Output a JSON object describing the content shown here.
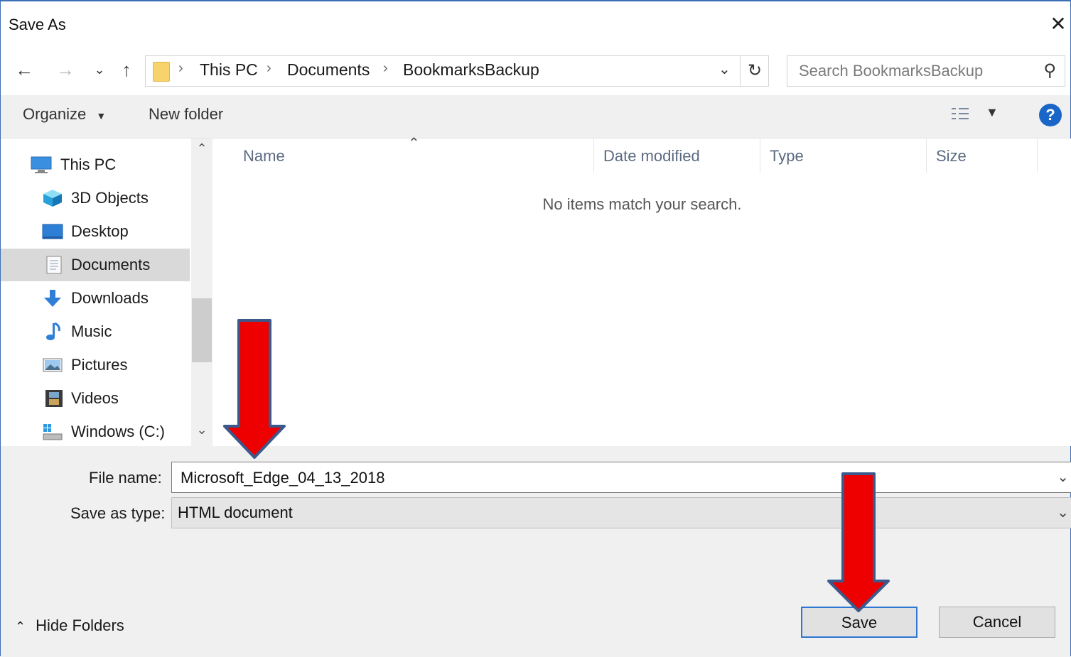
{
  "window": {
    "title": "Save As"
  },
  "nav": {
    "breadcrumbs": [
      "This PC",
      "Documents",
      "BookmarksBackup"
    ],
    "search_placeholder": "Search BookmarksBackup"
  },
  "toolbar": {
    "organize": "Organize",
    "new_folder": "New folder",
    "help": "?"
  },
  "sidebar": {
    "items": [
      {
        "label": "This PC",
        "icon": "computer-icon"
      },
      {
        "label": "3D Objects",
        "icon": "cube-icon"
      },
      {
        "label": "Desktop",
        "icon": "desktop-icon"
      },
      {
        "label": "Documents",
        "icon": "document-icon",
        "selected": true
      },
      {
        "label": "Downloads",
        "icon": "download-arrow-icon"
      },
      {
        "label": "Music",
        "icon": "music-note-icon"
      },
      {
        "label": "Pictures",
        "icon": "picture-icon"
      },
      {
        "label": "Videos",
        "icon": "film-icon"
      },
      {
        "label": "Windows (C:)",
        "icon": "drive-icon"
      }
    ]
  },
  "filelist": {
    "columns": [
      "Name",
      "Date modified",
      "Type",
      "Size"
    ],
    "empty_message": "No items match your search."
  },
  "form": {
    "file_name_label": "File name:",
    "file_name_value": "Microsoft_Edge_04_13_2018",
    "save_type_label": "Save as type:",
    "save_type_value": "HTML document"
  },
  "footer": {
    "hide_folders": "Hide Folders",
    "save": "Save",
    "cancel": "Cancel"
  },
  "colors": {
    "accent": "#2f78d1",
    "annotation_arrow": "#ee0000",
    "arrow_outline": "#3b5a8c"
  }
}
